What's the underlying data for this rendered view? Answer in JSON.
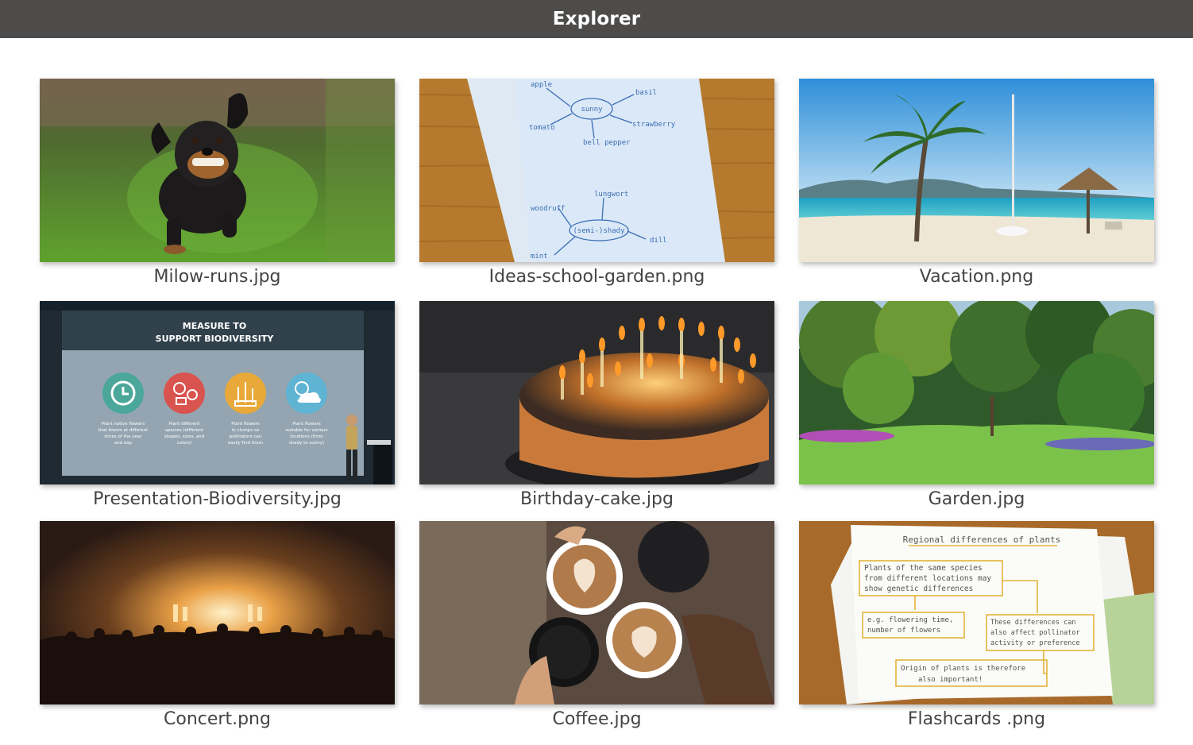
{
  "window": {
    "title": "Explorer"
  },
  "files": [
    {
      "name": "Milow-runs.jpg"
    },
    {
      "name": "Ideas-school-garden.png"
    },
    {
      "name": "Vacation.png"
    },
    {
      "name": "Presentation-Biodiversity.jpg"
    },
    {
      "name": "Birthday-cake.jpg"
    },
    {
      "name": "Garden.jpg"
    },
    {
      "name": "Concert.png"
    },
    {
      "name": "Coffee.jpg"
    },
    {
      "name": "Flashcards .png"
    }
  ],
  "thumbnails": {
    "mindmap": {
      "center1": "sunny",
      "words1": [
        "apple",
        "basil",
        "tomato",
        "strawberry",
        "bell pepper"
      ],
      "center2": "(semi-)shady",
      "words2": [
        "lungwort",
        "woodruff",
        "dill",
        "mint"
      ]
    },
    "slide": {
      "heading_line1": "MEASURE TO",
      "heading_line2": "SUPPORT BIODIVERSITY",
      "items": [
        [
          "Plant native flowers",
          "that bloom at different",
          "times of the year",
          "and day"
        ],
        [
          "Plant different",
          "species (different",
          "shapes, sizes, and",
          "colors)"
        ],
        [
          "Plant flowers",
          "in clumps so",
          "pollinators can",
          "easily find them"
        ],
        [
          "Plant flowers",
          "suitable for various",
          "locations (from",
          "shady to sunny)"
        ]
      ]
    },
    "flashcard": {
      "heading": "Regional differences of plants",
      "box1": [
        "Plants of the same species",
        "from different locations may",
        "show genetic differences"
      ],
      "box2": [
        "e.g. flowering time,",
        "number of flowers"
      ],
      "box3": [
        "These differences can",
        "also affect pollinator",
        "activity or preference"
      ],
      "box4": [
        "Origin of plants is therefore",
        "also important!"
      ]
    }
  },
  "colors": {
    "titlebar": "#4d4c4a",
    "caption": "#444444",
    "slide_teal": "#4aa79a",
    "slide_red": "#d9534f",
    "slide_amber": "#e8a93a",
    "slide_sky": "#5fb3d3"
  }
}
